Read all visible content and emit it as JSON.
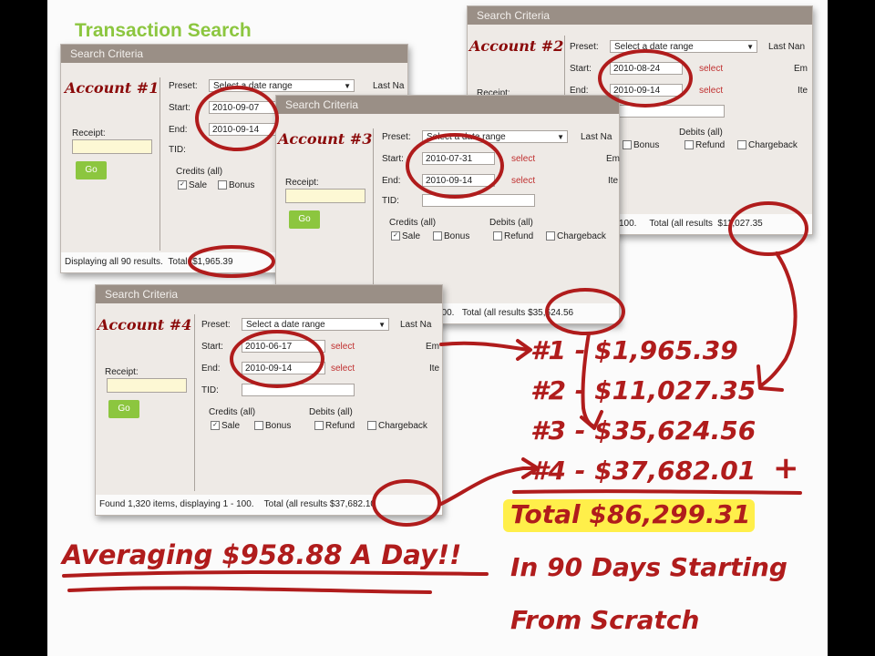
{
  "page_title": "Transaction Search",
  "accounts": [
    {
      "header": "Search Criteria",
      "account_label": "Account #1",
      "preset_label": "Preset:",
      "preset_value": "Select a date range",
      "last_name_label": "Last Na",
      "start_label": "Start:",
      "start_value": "2010-09-07",
      "end_label": "End:",
      "end_value": "2010-09-14",
      "tid_label": "TID:",
      "receipt_label": "Receipt:",
      "go_label": "Go",
      "credits_label": "Credits  (all)",
      "sale_label": "Sale",
      "bonus_label": "Bonus",
      "footer_text": "Displaying all 90 results.",
      "total_text": "Total: $1,965.39"
    },
    {
      "header": "Search Criteria",
      "account_label": "Account #2",
      "preset_label": "Preset:",
      "preset_value": "Select a date range",
      "last_name_label": "Last Nan",
      "start_label": "Start:",
      "start_value": "2010-08-24",
      "end_label": "End:",
      "end_value": "2010-09-14",
      "select_label": "select",
      "receipt_label": "Receipt:",
      "em_label": "Em",
      "it_label": "Ite",
      "debits_label": "Debits  (all)",
      "bonus_label": "Bonus",
      "refund_label": "Refund",
      "chargeback_label": "Chargeback",
      "footer_text": "100.",
      "total_text": "Total (all results",
      "total_value": "$11,027.35"
    },
    {
      "header": "Search Criteria",
      "account_label": "Account #3",
      "preset_label": "Preset:",
      "preset_value": "Select a date range",
      "last_name_label": "Last Na",
      "start_label": "Start:",
      "start_value": "2010-07-31",
      "end_label": "End:",
      "end_value": "2010-09-14",
      "select_label": "select",
      "receipt_label": "Receipt:",
      "tid_label": "TID:",
      "go_label": "Go",
      "em_label": "Em",
      "it_label": "Ite",
      "credits_label": "Credits  (all)",
      "debits_label": "Debits  (all)",
      "sale_label": "Sale",
      "bonus_label": "Bonus",
      "refund_label": "Refund",
      "chargeback_label": "Chargeback",
      "footer_text": "100.",
      "total_text": "Total (all results",
      "total_value": "$35,624.56"
    },
    {
      "header": "Search Criteria",
      "account_label": "Account #4",
      "preset_label": "Preset:",
      "preset_value": "Select a date range",
      "last_name_label": "Last Na",
      "start_label": "Start:",
      "start_value": "2010-06-17",
      "end_label": "End:",
      "end_value": "2010-09-14",
      "select_label": "select",
      "receipt_label": "Receipt:",
      "tid_label": "TID:",
      "go_label": "Go",
      "em_label": "Em",
      "it_label": "Ite",
      "credits_label": "Credits  (all)",
      "debits_label": "Debits  (all)",
      "sale_label": "Sale",
      "bonus_label": "Bonus",
      "refund_label": "Refund",
      "chargeback_label": "Chargeback",
      "footer_text": "Found 1,320 items, displaying 1 - 100.",
      "total_text": "Total (all results",
      "total_value": "$37,682.10"
    }
  ],
  "annotations": {
    "line1": "#1 - $1,965.39",
    "line2": "#2 - $11,027.35",
    "line3": "#3 - $35,624.56",
    "line4": "#4 - $37,682.01",
    "plus": "+",
    "total": "Total $86,299.31",
    "averaging": "Averaging $958.88 A Day!!",
    "caption_line1": "In 90 Days Starting",
    "caption_line2": "From Scratch"
  },
  "colors": {
    "ink_red": "#b01c1c",
    "header_brown": "#9a8f86",
    "go_green": "#8cc63f",
    "highlight_yellow": "#ffef4a"
  }
}
